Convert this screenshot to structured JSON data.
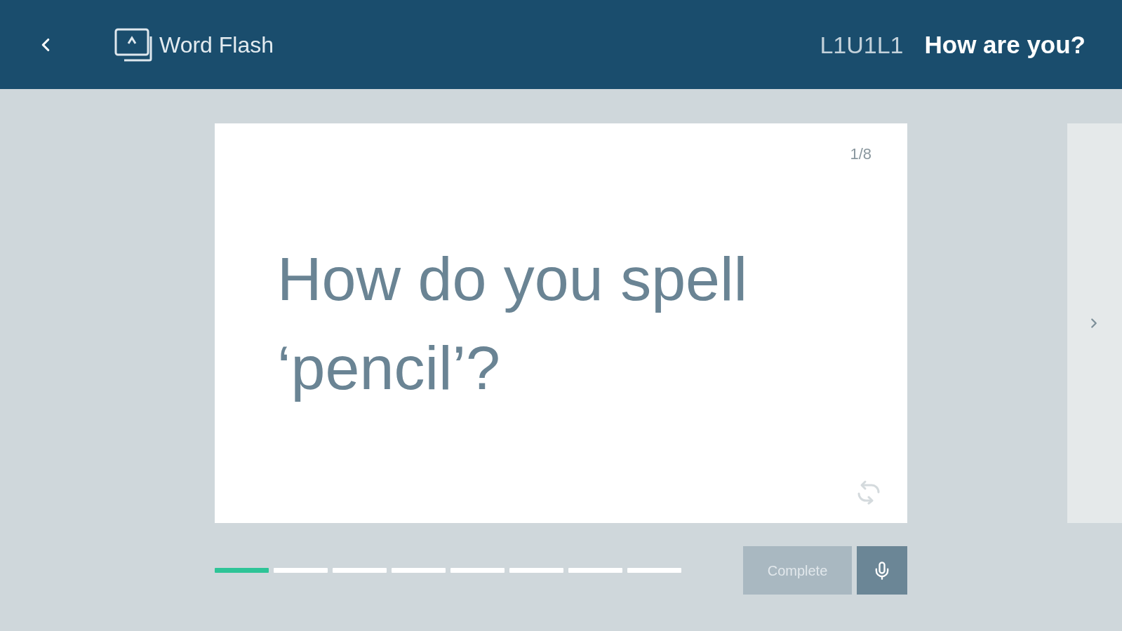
{
  "header": {
    "app_title": "Word Flash",
    "lesson_code": "L1U1L1",
    "lesson_title": "How are you?"
  },
  "card": {
    "counter": "1/8",
    "question": "How do you spell ‘pencil’?"
  },
  "progress": {
    "segments": [
      {
        "done": true
      },
      {
        "done": false
      },
      {
        "done": false
      },
      {
        "done": false
      },
      {
        "done": false
      },
      {
        "done": false
      },
      {
        "done": false
      },
      {
        "done": false
      }
    ]
  },
  "complete_button": {
    "label": "Complete",
    "disabled": true
  }
}
